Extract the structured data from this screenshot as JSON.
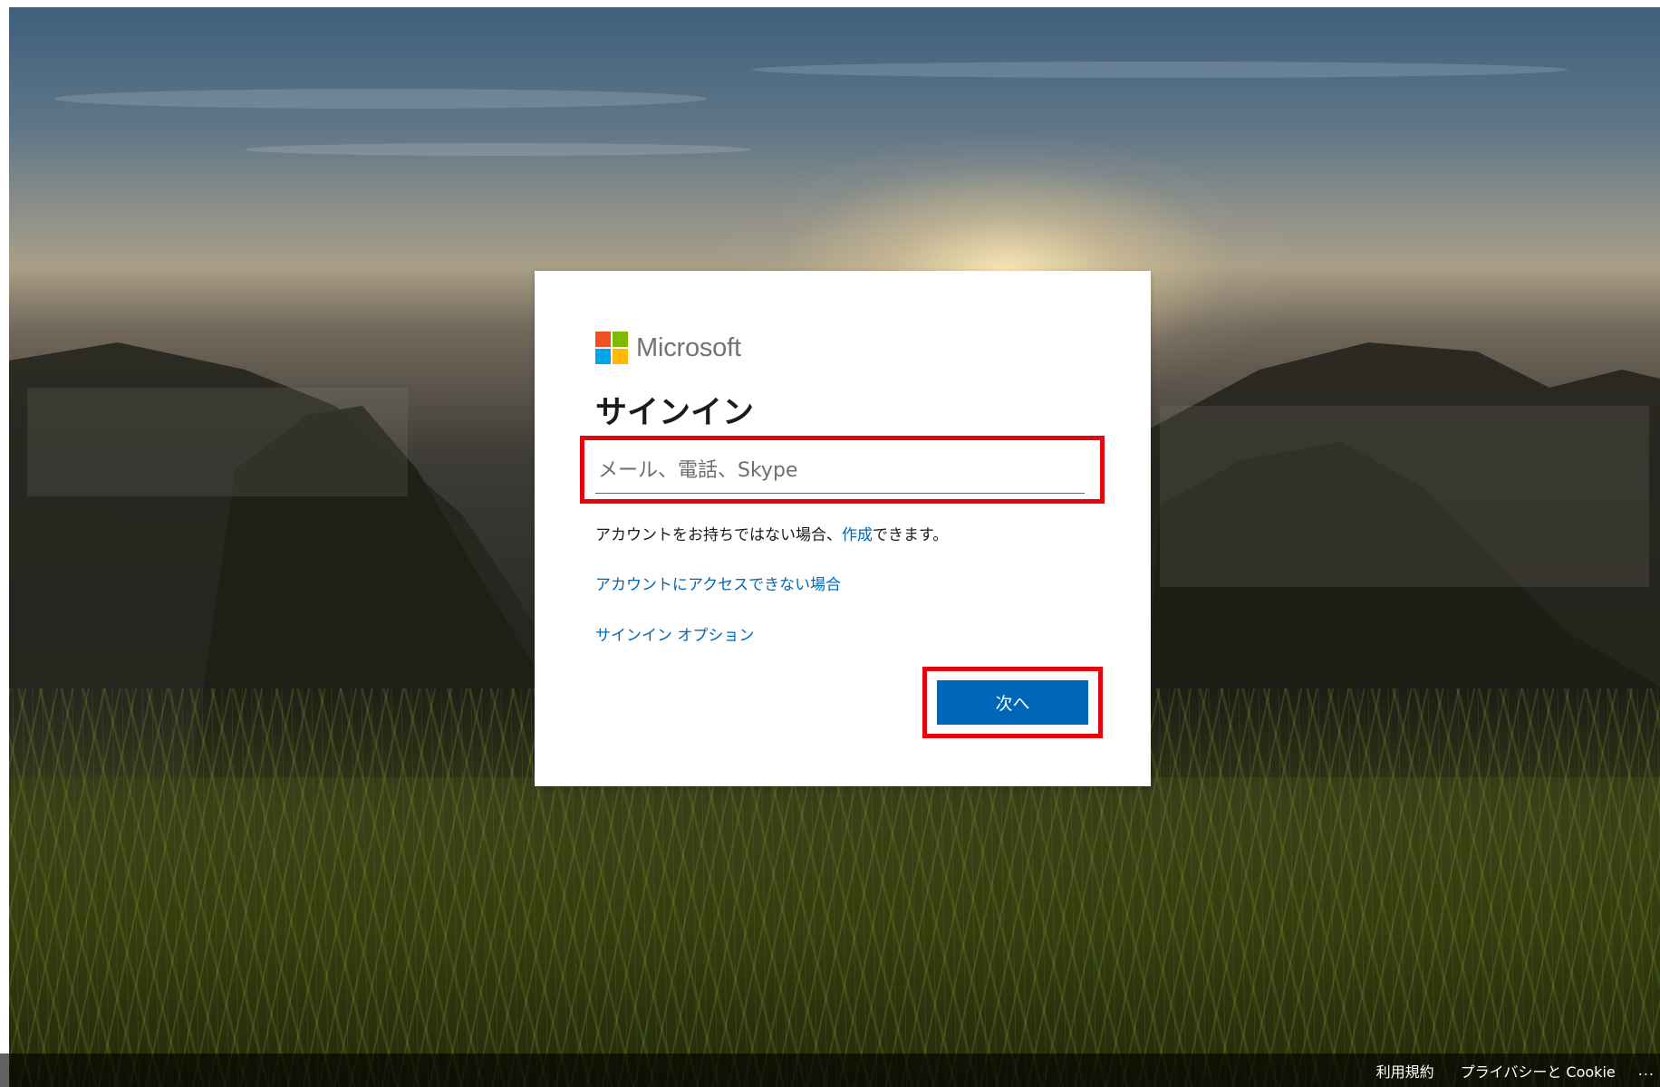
{
  "brand": {
    "name": "Microsoft",
    "logo_colors": [
      "#f25022",
      "#7fba00",
      "#00a4ef",
      "#ffb900"
    ]
  },
  "signin": {
    "title": "サインイン",
    "email_placeholder": "メール、電話、Skype",
    "email_value": "",
    "no_account_prefix": "アカウントをお持ちではない場合、",
    "create_link": "作成",
    "no_account_suffix": "できます。",
    "cant_access_link": "アカウントにアクセスできない場合",
    "options_link": "サインイン オプション",
    "next_button": "次へ"
  },
  "annotations": {
    "highlight_color": "#e2070e",
    "highlighted": [
      "email-input",
      "next-button"
    ]
  },
  "footer": {
    "terms": "利用規約",
    "privacy": "プライバシーと Cookie",
    "more": "..."
  },
  "colors": {
    "accent": "#0067b8",
    "text": "#1b1b1b"
  }
}
